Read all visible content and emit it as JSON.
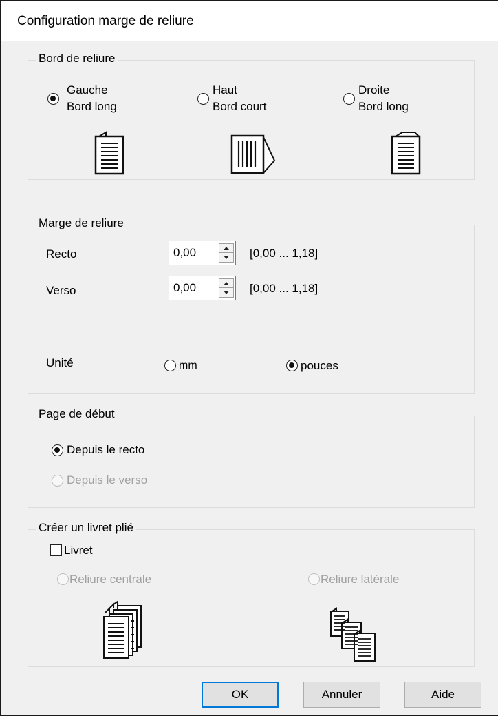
{
  "window": {
    "title": "Configuration marge de reliure"
  },
  "binding_edge": {
    "legend": "Bord de reliure",
    "options": [
      {
        "line1": "Gauche",
        "line2": "Bord long",
        "checked": true,
        "icon": "left-bound-page-icon"
      },
      {
        "line1": "Haut",
        "line2": "Bord court",
        "checked": false,
        "icon": "top-bound-page-icon"
      },
      {
        "line1": "Droite",
        "line2": "Bord long",
        "checked": false,
        "icon": "right-bound-page-icon"
      }
    ]
  },
  "margin": {
    "legend": "Marge de reliure",
    "front": {
      "label": "Recto",
      "value": "0,00",
      "range": "[0,00 ... 1,18]"
    },
    "back": {
      "label": "Verso",
      "value": "0,00",
      "range": "[0,00 ... 1,18]"
    },
    "unit": {
      "label": "Unité",
      "options": [
        "mm",
        "pouces"
      ],
      "selected": "pouces"
    }
  },
  "start_page": {
    "legend": "Page de début",
    "options": [
      {
        "label": "Depuis le recto",
        "checked": true,
        "enabled": true
      },
      {
        "label": "Depuis le verso",
        "checked": false,
        "enabled": false
      }
    ]
  },
  "booklet": {
    "legend": "Créer un livret plié",
    "checkbox_label": "Livret",
    "checked": false,
    "options": [
      {
        "label": "Reliure centrale",
        "enabled": false,
        "icon": "center-binding-icon"
      },
      {
        "label": "Reliure latérale",
        "enabled": false,
        "icon": "side-binding-icon"
      }
    ]
  },
  "buttons": {
    "ok": "OK",
    "cancel": "Annuler",
    "help": "Aide"
  }
}
